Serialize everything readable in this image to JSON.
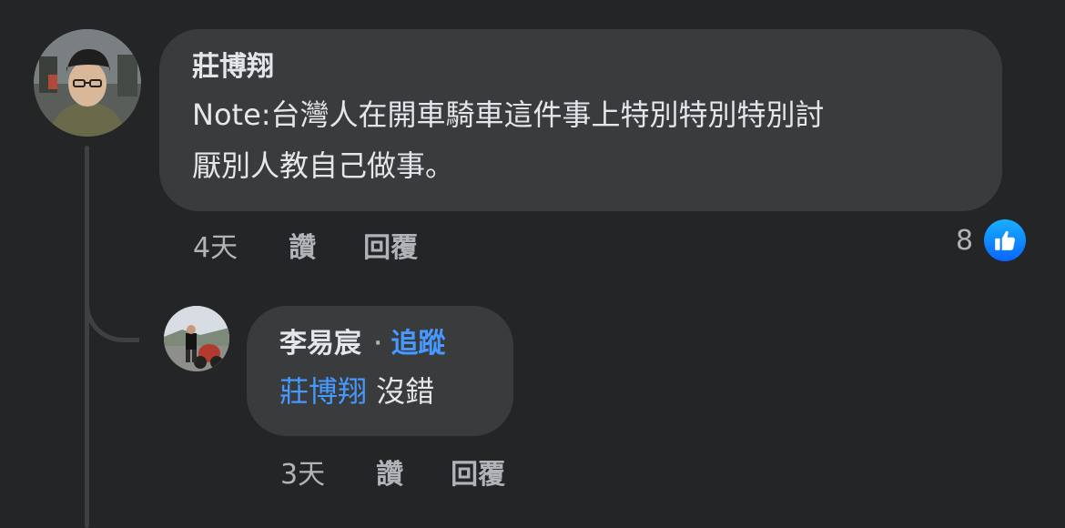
{
  "comment": {
    "author": "莊博翔",
    "text_line1": "Note:台灣人在開車騎車這件事上特別特別特別討",
    "text_line2": "厭別人教自己做事。",
    "time": "4天",
    "like_label": "讚",
    "reply_label": "回覆",
    "reaction_count": "8",
    "reaction_icon": "thumbs-up-icon",
    "reaction_color": "#0866ff"
  },
  "reply": {
    "author": "李易宸",
    "separator": "·",
    "follow_label": "追蹤",
    "mention": "莊博翔",
    "text": "沒錯",
    "time": "3天",
    "like_label": "讚",
    "reply_label": "回覆"
  },
  "colors": {
    "background": "#242527",
    "bubble": "#3a3b3c",
    "link": "#4599ff",
    "muted": "#b0b3b8"
  }
}
